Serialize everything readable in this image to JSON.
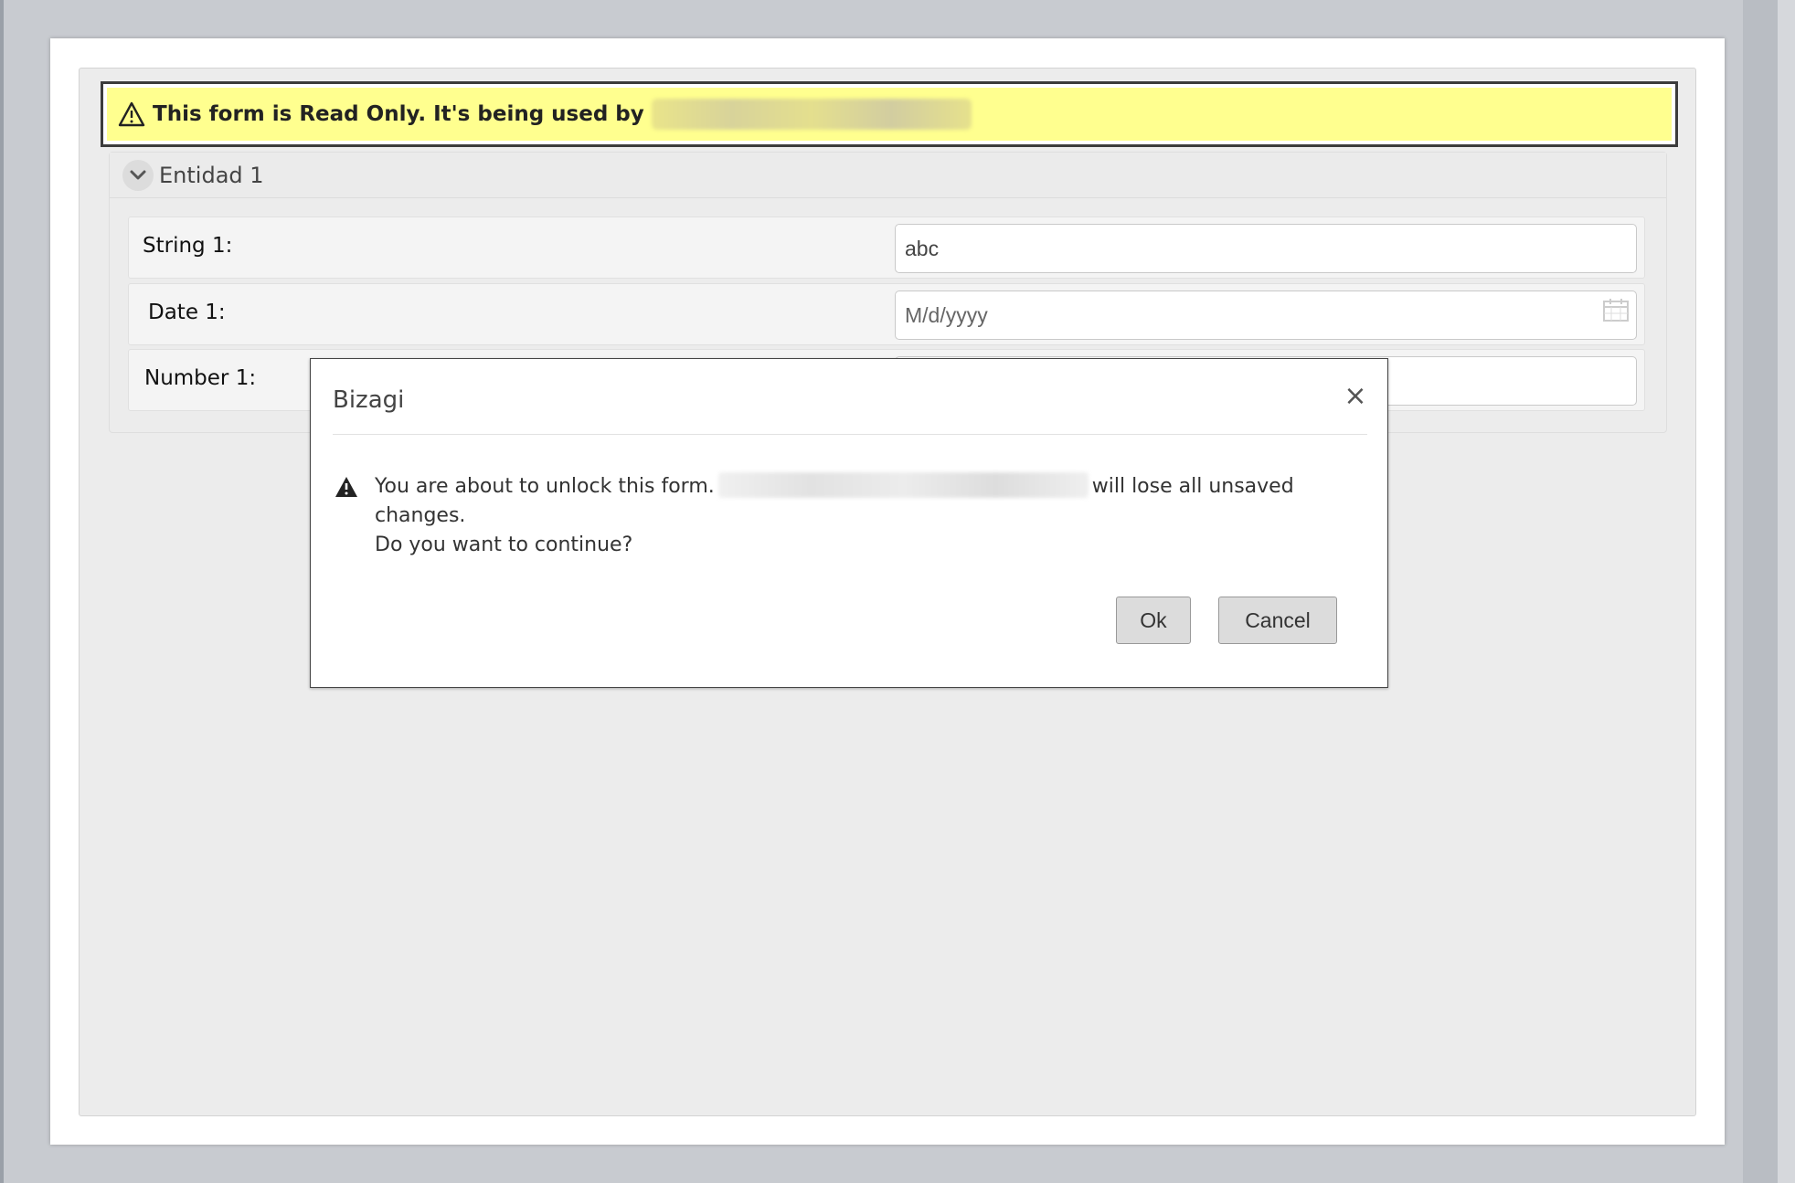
{
  "banner": {
    "message": "This form is Read Only. It's being used by"
  },
  "section": {
    "title": "Entidad 1"
  },
  "fields": [
    {
      "label": "String 1:",
      "value": "abc",
      "placeholder": ""
    },
    {
      "label": "Date 1:",
      "value": "",
      "placeholder": "M/d/yyyy"
    },
    {
      "label": "Number 1:",
      "value": "",
      "placeholder": ""
    }
  ],
  "dialog": {
    "title": "Bizagi",
    "message_part1": "You are about to unlock this form.",
    "message_part2": "will lose all unsaved changes.",
    "message_line2": "Do you want to continue?",
    "ok_label": "Ok",
    "cancel_label": "Cancel",
    "close_symbol": "×"
  },
  "icons": {
    "banner_icon": "warning-outline-icon",
    "dialog_icon": "warning-filled-icon",
    "section_toggle": "chevron-down-icon",
    "date_picker": "calendar-icon"
  },
  "colors": {
    "banner_background": "#ffff8f",
    "form_background": "#ececec",
    "button_background": "#dcdcdc"
  }
}
